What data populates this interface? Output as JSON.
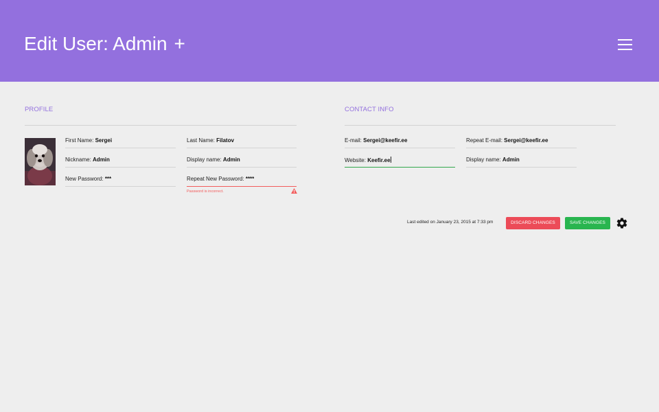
{
  "header": {
    "title": "Edit User: Admin",
    "add_icon": "+",
    "menu_icon": "hamburger-menu-icon",
    "bg_color": "#9370de"
  },
  "profile": {
    "section_title": "PROFILE",
    "avatar": "dog-photo-avatar",
    "first_name": {
      "label": "First Name:",
      "value": "Sergei"
    },
    "last_name": {
      "label": "Last Name:",
      "value": "Filatov"
    },
    "nickname": {
      "label": "Nickname:",
      "value": "Admin"
    },
    "display_name": {
      "label": "Display name:",
      "value": "Admin"
    },
    "new_password": {
      "label": "New Password:",
      "value": "***"
    },
    "repeat_password": {
      "label": "Repeat New Password:",
      "value": "****"
    },
    "error_message": "Password is incorrect.",
    "error_color": "#f25b5b"
  },
  "contact": {
    "section_title": "CONTACT INFO",
    "email": {
      "label": "E-mail:",
      "value": "Sergei@keefir.ee"
    },
    "repeat_email": {
      "label": "Repeat E-mail:",
      "value": "Sergei@keefir.ee"
    },
    "website": {
      "label": "Website:",
      "value": "Keefir.ee"
    },
    "display_name": {
      "label": "Display name:",
      "value": "Admin"
    },
    "active_color": "#31a84b"
  },
  "footer": {
    "last_edited": "Last edited on January 23, 2015 at 7:33 pm",
    "discard_label": "DISCARD CHANGES",
    "save_label": "SAVE CHANGES",
    "discard_color": "#ec4b58",
    "save_color": "#29b54f",
    "settings_icon": "gear-icon"
  }
}
